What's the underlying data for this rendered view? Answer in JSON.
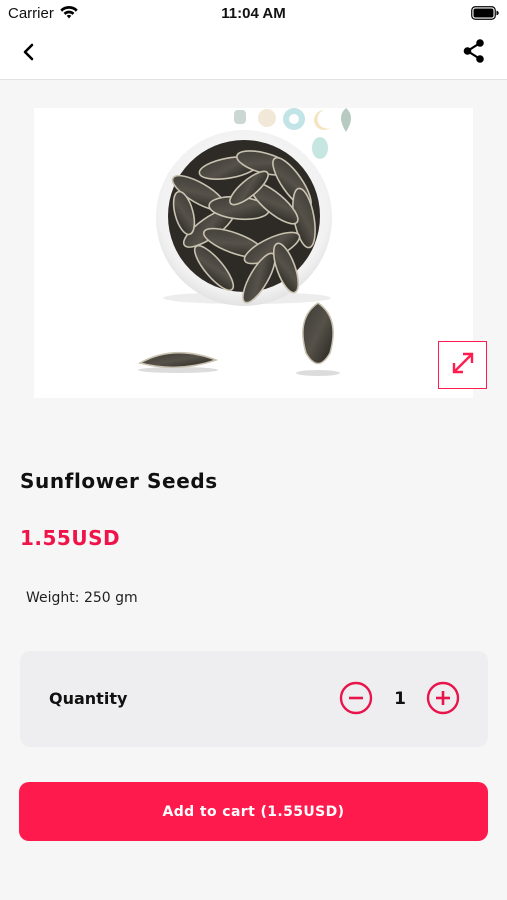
{
  "status_bar": {
    "carrier": "Carrier",
    "time": "11:04 AM"
  },
  "nav": {
    "back_icon": "chevron-left-icon",
    "share_icon": "share-icon"
  },
  "product": {
    "name": "Sunflower Seeds",
    "price": "1.55USD",
    "weight": "Weight: 250 gm",
    "image_desc": "bowl of sunflower seeds",
    "expand_icon": "expand-icon"
  },
  "quantity": {
    "label": "Quantity",
    "value": "1"
  },
  "cart": {
    "button_label": "Add to cart (1.55USD)"
  },
  "colors": {
    "accent": "#ff1a4d",
    "price": "#f0134a",
    "background": "#f6f6f7"
  }
}
